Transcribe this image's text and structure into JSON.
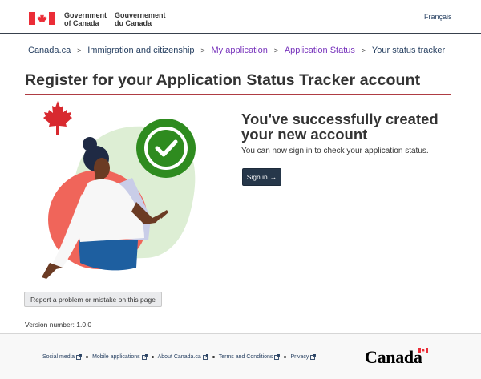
{
  "header": {
    "signature_en": [
      "Government",
      "of Canada"
    ],
    "signature_fr": [
      "Gouvernement",
      "du Canada"
    ],
    "language_toggle": "Français"
  },
  "breadcrumb": [
    {
      "label": "Canada.ca",
      "visited": false
    },
    {
      "label": "Immigration and citizenship",
      "visited": false
    },
    {
      "label": "My application",
      "visited": true
    },
    {
      "label": "Application Status",
      "visited": true
    },
    {
      "label": "Your status tracker",
      "visited": false
    }
  ],
  "page": {
    "title": "Register for your Application Status Tracker account"
  },
  "success": {
    "heading": "You've successfully created your new account",
    "message": "You can now sign in to check your application status.",
    "signin_label": "Sign in",
    "signin_arrow": "→"
  },
  "report": {
    "label": "Report a problem or mistake on this page"
  },
  "version": {
    "text": "Version number: 1.0.0"
  },
  "footer": {
    "links": [
      "Social media",
      "Mobile applications",
      "About Canada.ca",
      "Terms and Conditions",
      "Privacy"
    ],
    "wordmark": "Canada"
  },
  "colors": {
    "primary": "#26374a",
    "accent_red": "#af3c43",
    "flag_red": "#eb2d37",
    "visited_link": "#7834bc",
    "check_green": "#2e8b1f"
  }
}
